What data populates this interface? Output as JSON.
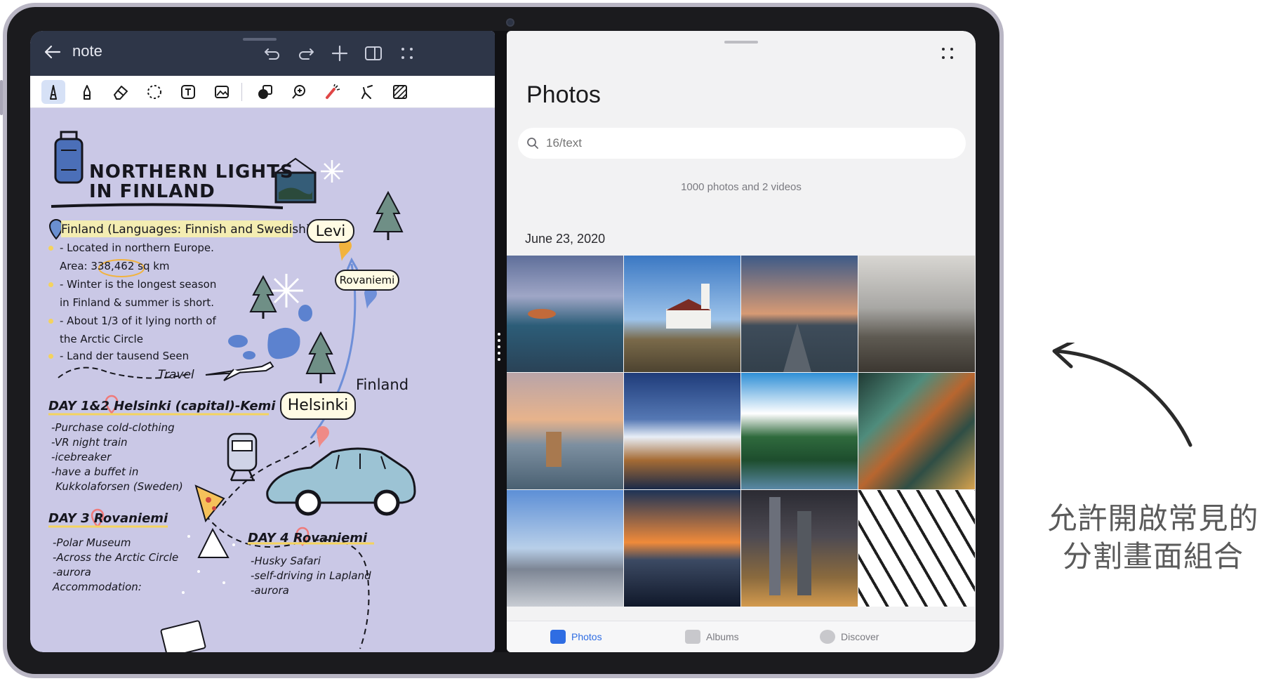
{
  "note_app": {
    "title": "note",
    "heading_line1": "NORTHERN LIGHTS",
    "heading_line2": "IN FINLAND",
    "country_line": "Finland (Languages: Finnish and Swedish)",
    "facts": [
      "- Located in northern Europe.",
      "Area: 338,462 sq km",
      "- Winter is the longest season",
      "in Finland &  summer is short.",
      "- About 1/3 of it lying north of",
      "the Arctic Circle",
      "- Land der tausend Seen"
    ],
    "travel_label": "Travel",
    "finland_label": "Finland",
    "bubbles": {
      "levi": "Levi",
      "rovaniemi": "Rovaniemi",
      "helsinki": "Helsinki"
    },
    "day12": {
      "title": "DAY 1&2 Helsinki (capital)-Kemi",
      "items": [
        "-Purchase cold-clothing",
        "-VR night train",
        "-icebreaker",
        "-have a buffet in",
        "Kukkolaforsen (Sweden)"
      ]
    },
    "day3": {
      "title": "DAY 3 Rovaniemi",
      "items": [
        "-Polar Museum",
        "-Across the Arctic Circle",
        "-aurora",
        "Accommodation:"
      ]
    },
    "day4": {
      "title": "DAY 4 Rovaniemi",
      "items": [
        "-Husky Safari",
        "-self-driving in Lapland",
        "-aurora"
      ]
    }
  },
  "photos_app": {
    "title": "Photos",
    "search_placeholder": "16/text",
    "count_text": "1000 photos and 2 videos",
    "date_header": "June 23, 2020",
    "tabs": {
      "photos": "Photos",
      "albums": "Albums",
      "discover": "Discover"
    },
    "accent_color": "#2f6de3"
  },
  "caption": {
    "line1": "允許開啟常見的",
    "line2": "分割畫面組合"
  }
}
